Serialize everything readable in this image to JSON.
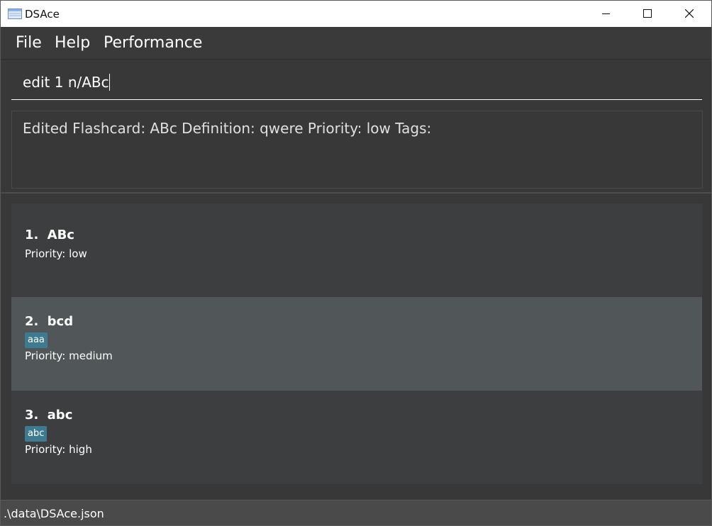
{
  "window": {
    "title": "DSAce"
  },
  "menu": {
    "items": [
      {
        "label": "File"
      },
      {
        "label": "Help"
      },
      {
        "label": "Performance"
      }
    ]
  },
  "command": {
    "value": "edit 1 n/ABc"
  },
  "result": {
    "message": "Edited Flashcard: ABc Definition: qwere Priority: low Tags:"
  },
  "flashcards": [
    {
      "index": "1.",
      "name": "ABc",
      "tags": [],
      "priority": "Priority: low",
      "selected": false
    },
    {
      "index": "2.",
      "name": "bcd",
      "tags": [
        "aaa"
      ],
      "priority": "Priority: medium",
      "selected": true
    },
    {
      "index": "3.",
      "name": "abc",
      "tags": [
        "abc"
      ],
      "priority": "Priority: high",
      "selected": false
    }
  ],
  "status": {
    "file_path": ".\\data\\DSAce.json"
  },
  "colors": {
    "background": "#383838",
    "selected_card": "#515658",
    "tag": "#3e7b91"
  }
}
